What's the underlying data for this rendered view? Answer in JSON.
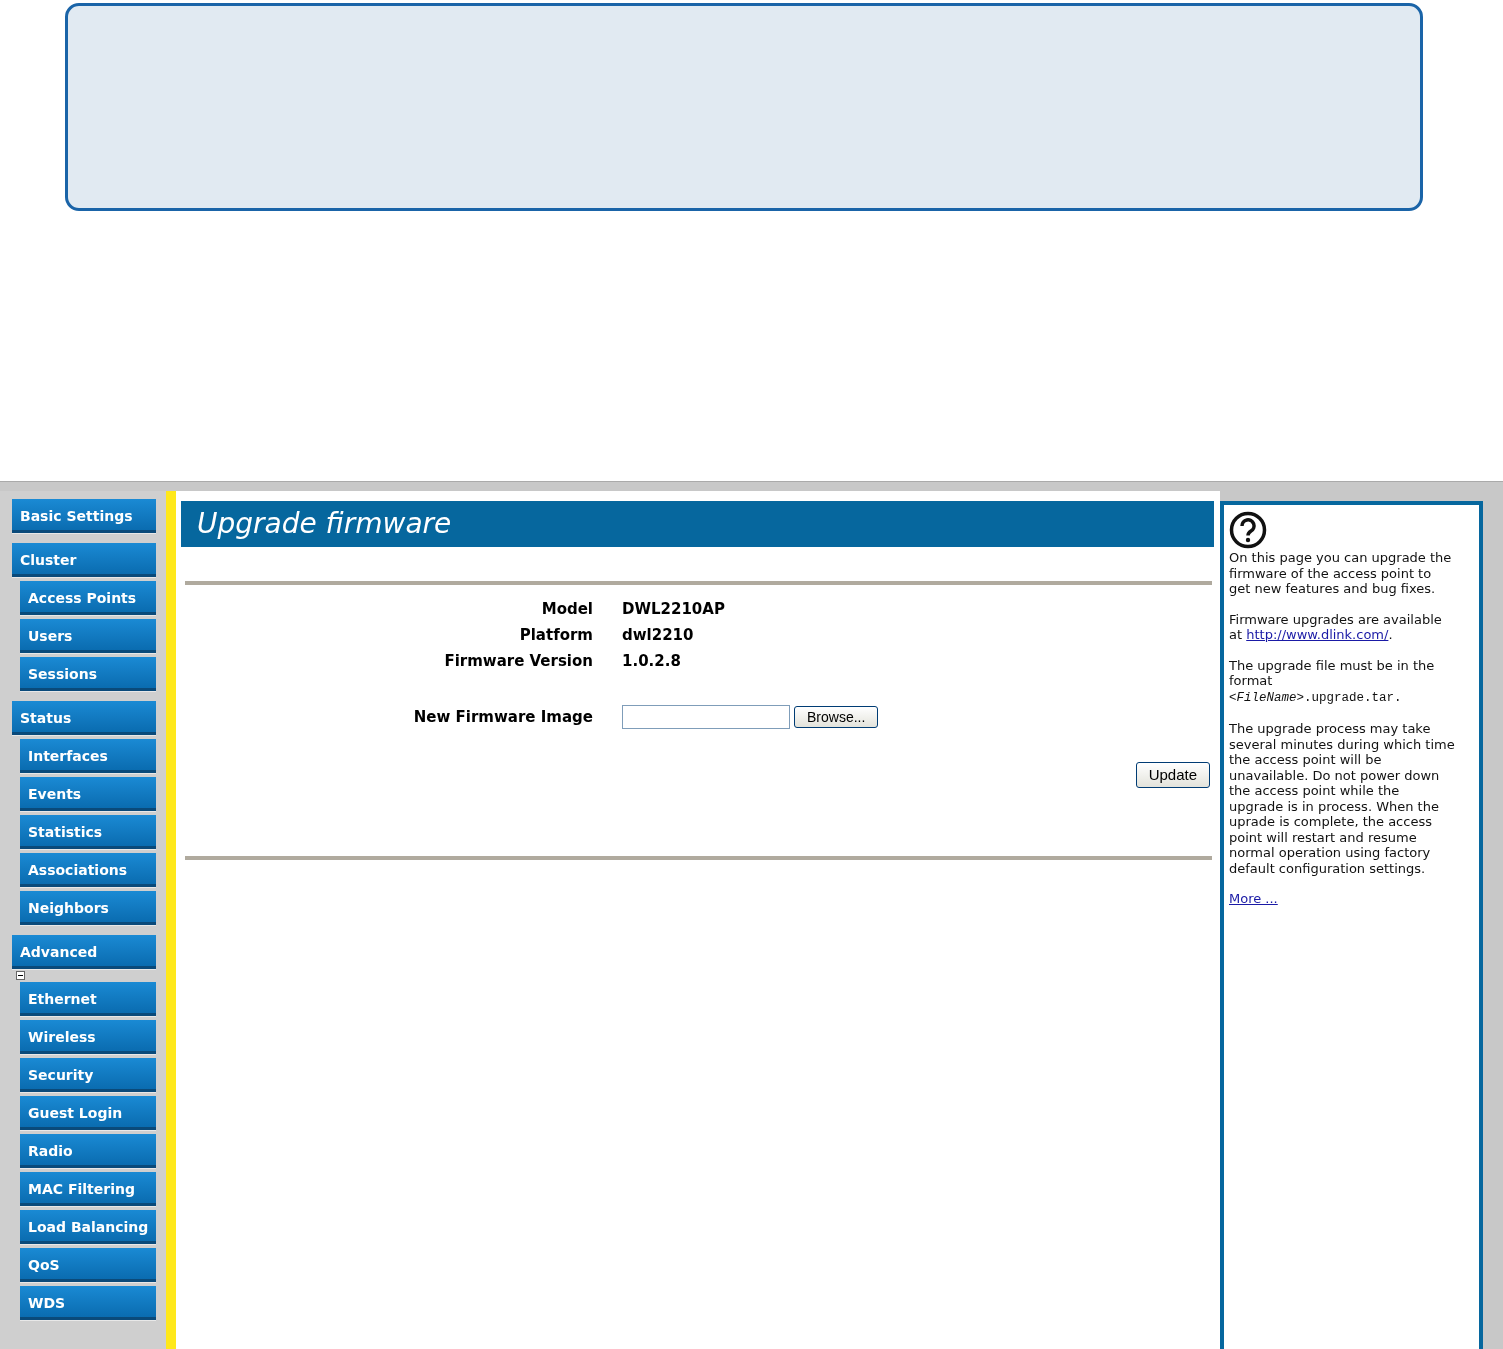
{
  "sidebar": {
    "groups": [
      {
        "label": "Basic Settings"
      },
      {
        "label": "Cluster",
        "children": [
          {
            "label": "Access Points"
          },
          {
            "label": "Users"
          },
          {
            "label": "Sessions"
          }
        ]
      },
      {
        "label": "Status",
        "children": [
          {
            "label": "Interfaces"
          },
          {
            "label": "Events"
          },
          {
            "label": "Statistics"
          },
          {
            "label": "Associations"
          },
          {
            "label": "Neighbors"
          }
        ]
      },
      {
        "label": "Advanced",
        "expanded": true,
        "children": [
          {
            "label": "Ethernet"
          },
          {
            "label": "Wireless"
          },
          {
            "label": "Security"
          },
          {
            "label": "Guest Login"
          },
          {
            "label": "Radio"
          },
          {
            "label": "MAC Filtering"
          },
          {
            "label": "Load Balancing"
          },
          {
            "label": "QoS"
          },
          {
            "label": "WDS"
          }
        ]
      }
    ]
  },
  "page": {
    "title": "Upgrade firmware",
    "fields": [
      {
        "label": "Model",
        "value": "DWL2210AP"
      },
      {
        "label": "Platform",
        "value": "dwl2210"
      },
      {
        "label": "Firmware Version",
        "value": "1.0.2.8"
      }
    ],
    "upload": {
      "label": "New Firmware Image",
      "browse": "Browse..."
    },
    "update_button": "Update"
  },
  "help": {
    "paragraphs": [
      {
        "kind": "text",
        "text": "On this page you can upgrade the firmware of the access point to get new features and bug fixes."
      },
      {
        "kind": "link",
        "before": "Firmware upgrades are available at",
        "link": "http://www.dlink.com/",
        "after": "."
      },
      {
        "kind": "format",
        "text": "The upgrade file must be in the format",
        "code": "*<FileName>*.upgrade.tar."
      },
      {
        "kind": "text",
        "text": "The upgrade process may take several minutes during which time the access point will be unavailable. Do not power down the access point while the upgrade is in process. When the uprade is complete, the access point will restart and resume normal operation using factory default configuration settings."
      }
    ],
    "more": "More ..."
  }
}
